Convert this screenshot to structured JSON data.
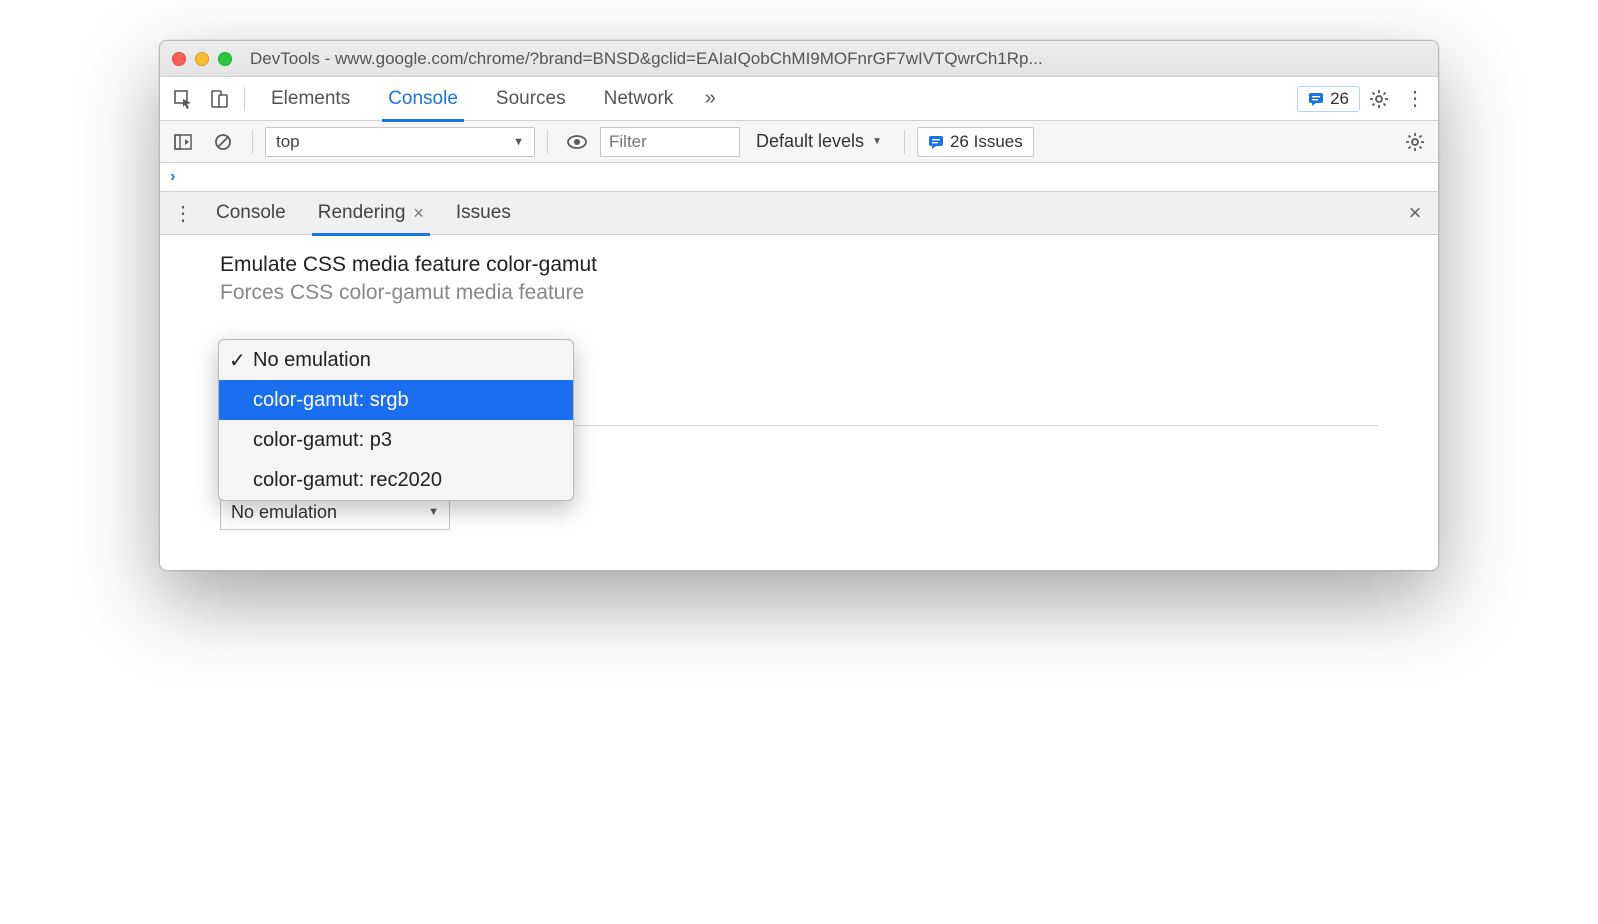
{
  "window": {
    "title": "DevTools - www.google.com/chrome/?brand=BNSD&gclid=EAIaIQobChMI9MOFnrGF7wIVTQwrCh1Rp..."
  },
  "main_tabs": {
    "items": [
      "Elements",
      "Console",
      "Sources",
      "Network"
    ],
    "active_index": 1,
    "overflow_glyph": "»"
  },
  "toolbar_right": {
    "issues_count": "26"
  },
  "console_toolbar": {
    "context": "top",
    "filter_placeholder": "Filter",
    "levels_label": "Default levels",
    "issues_label": "26 Issues"
  },
  "drawer": {
    "tabs": [
      "Console",
      "Rendering",
      "Issues"
    ],
    "active_index": 1
  },
  "rendering": {
    "setting_title": "Emulate CSS media feature color-gamut",
    "setting_desc": "Forces CSS color-gamut media feature",
    "dropdown": {
      "checked_index": 0,
      "highlight_index": 1,
      "options": [
        "No emulation",
        "color-gamut: srgb",
        "color-gamut: p3",
        "color-gamut: rec2020"
      ]
    },
    "obscured_tail": "lation",
    "next_select_value": "No emulation"
  }
}
